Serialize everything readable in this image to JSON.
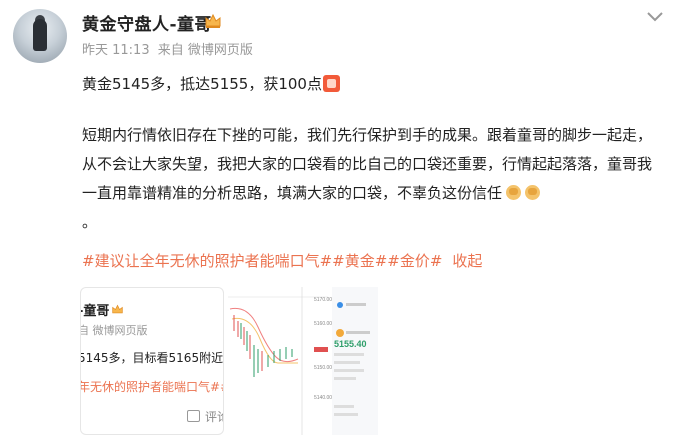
{
  "post": {
    "author": "黄金守盘人-童哥",
    "time": "昨天 11:13",
    "source": "来自 微博网页版",
    "line1": "黄金5145多，抵达5155，获100点",
    "body": "短期内行情依旧存在下挫的可能，我们先行保护到手的成果。跟着童哥的脚步一起走，从不会让大家失望，我把大家的口袋看的比自己的口袋还重要，行情起起落落，童哥我一直用靠谱精准的分析思路，填满大家的口袋，不辜负这份信任",
    "body_end": "。",
    "tags": [
      "#建议让全年无休的照护者能喘口气#",
      "#黄金#",
      "#金价#"
    ],
    "collapse": "收起"
  },
  "card": {
    "name": "-童哥",
    "meta": "自 微博网页版",
    "text": "5145多，目标看5165附近。",
    "tag": "年无休的照护者能喘口气##黄",
    "comment": "评论"
  },
  "chart_image": {
    "price": "5155.40",
    "labels": [
      "5170.00",
      "5160.00",
      "5150.00",
      "5140.00"
    ]
  },
  "colors": {
    "accent": "#eb7350",
    "text": "#222222",
    "meta": "#999999"
  }
}
